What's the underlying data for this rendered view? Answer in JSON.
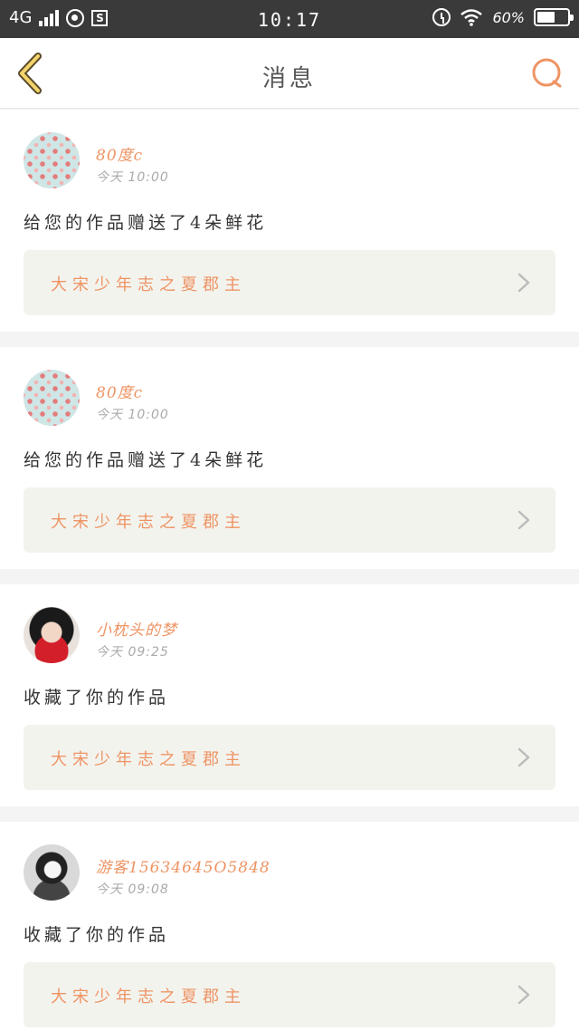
{
  "status_bar": {
    "network": "4G",
    "time": "10:17",
    "battery": "60%",
    "battery_level": 0.6
  },
  "header": {
    "title": "消息",
    "back_icon": "chevron-left-icon",
    "search_icon": "search-icon",
    "accent_color": "#EE9464"
  },
  "messages": [
    {
      "username": "80度c",
      "time": "今天 10:00",
      "text": "给您的作品赠送了4朵鲜花",
      "work": "大宋少年志之夏郡主"
    },
    {
      "username": "80度c",
      "time": "今天 10:00",
      "text": "给您的作品赠送了4朵鲜花",
      "work": "大宋少年志之夏郡主"
    },
    {
      "username": "小枕头的梦",
      "time": "今天 09:25",
      "text": "收藏了你的作品",
      "work": "大宋少年志之夏郡主"
    },
    {
      "username": "游客15634645O5848",
      "time": "今天 09:08",
      "text": "收藏了你的作品",
      "work": "大宋少年志之夏郡主"
    }
  ]
}
